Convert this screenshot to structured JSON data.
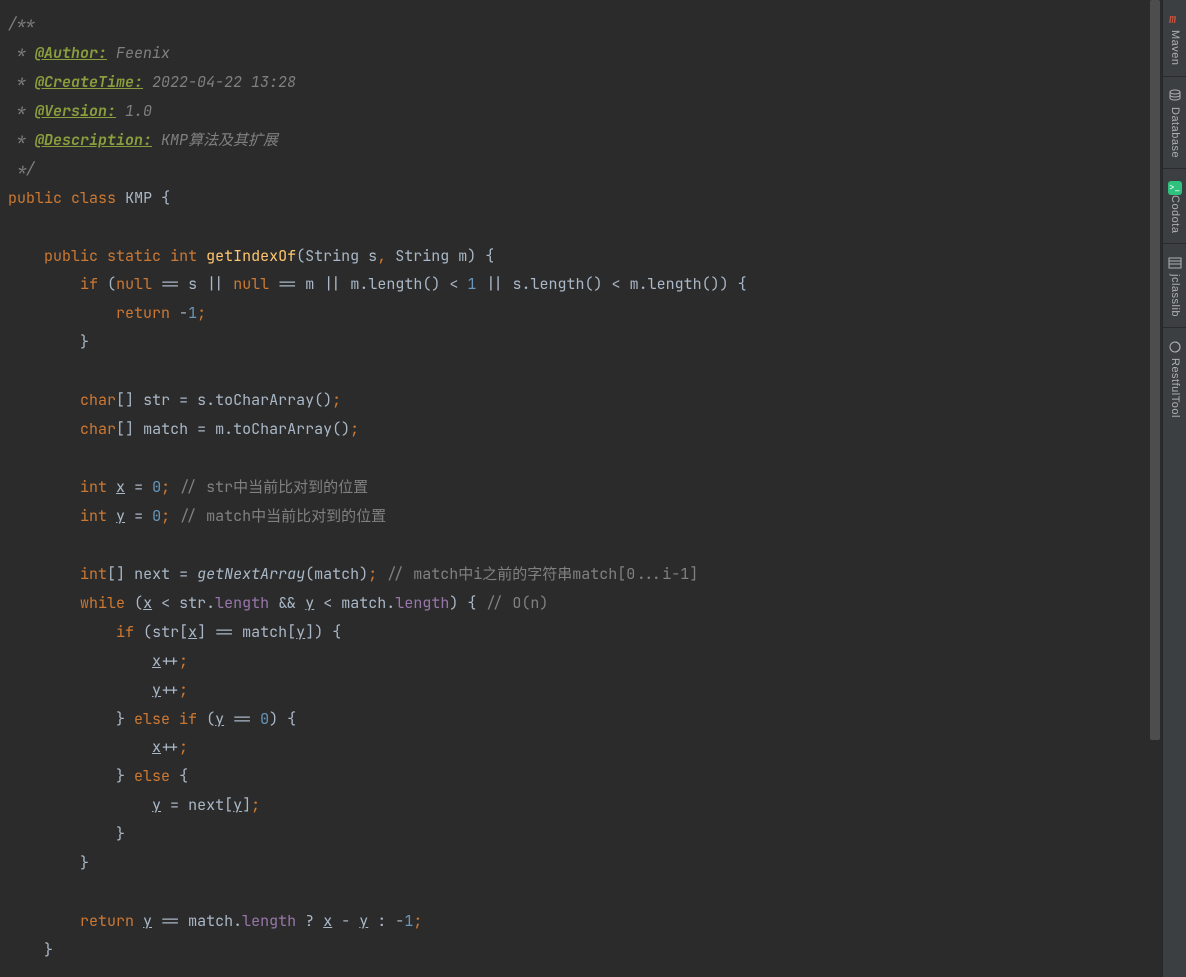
{
  "doc": {
    "open": "/**",
    "authorTag": "@Author:",
    "authorVal": " Feenix",
    "createTag": "@CreateTime:",
    "createVal": " 2022-04-22 13:28",
    "versionTag": "@Version:",
    "versionVal": " 1.0",
    "descTag": "@Description:",
    "descVal": " KMP算法及其扩展",
    "star": " * ",
    "close": " */"
  },
  "kw": {
    "public": "public",
    "class": "class",
    "static": "static",
    "int": "int",
    "if": "if",
    "null": "null",
    "return": "return",
    "char": "char",
    "while": "while",
    "elseif": "else if",
    "else": "else"
  },
  "names": {
    "className": "KMP",
    "getIndexOf": "getIndexOf",
    "String": "String",
    "s": "s",
    "m": "m",
    "length": "length",
    "lengthCall": "length()",
    "toCharArray": "toCharArray()",
    "str": "str",
    "match": "match",
    "x": "x",
    "y": "y",
    "next": "next",
    "getNextArray": "getNextArray"
  },
  "nums": {
    "neg1": "1",
    "zero": "0",
    "one": "1"
  },
  "comments": {
    "xpos": "// str中当前比对到的位置",
    "ypos": "// match中当前比对到的位置",
    "nextArr": "// match中i之前的字符串match[0...i-1]",
    "on": "// O(n)"
  },
  "toolbar": {
    "maven": "Maven",
    "database": "Database",
    "codota": "Codota",
    "jclasslib": "jclasslib",
    "restful": "RestfulTool"
  }
}
